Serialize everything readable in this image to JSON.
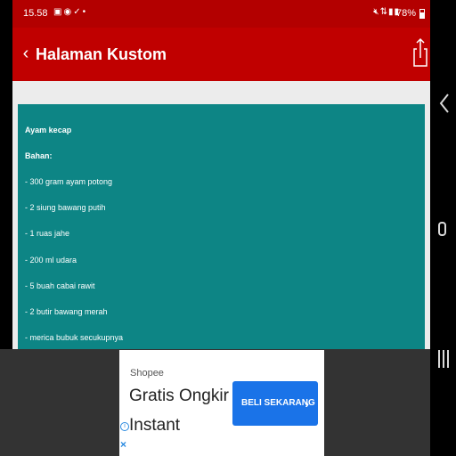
{
  "status_bar": {
    "time": "15.58",
    "left_icons": [
      "image-icon",
      "shield-icon",
      "check-icon",
      "dot-icon"
    ],
    "right_icons": [
      "mute-icon",
      "lte-icon",
      "signal-icon",
      "wifi-signal-icon"
    ],
    "battery_percent": "78%"
  },
  "app_bar": {
    "back_icon": "chevron-left-icon",
    "title": "Halaman Kustom",
    "share_icon": "share-icon"
  },
  "recipe": {
    "lines": [
      "Ayam kecap",
      "Bahan:",
      "- 300 gram ayam potong",
      "- 2 siung bawang putih",
      "- 1 ruas jahe",
      "- 200 ml udara",
      "- 5 buah cabai rawit",
      "- 2 butir bawang merah",
      "- merica bubuk secukupnya"
    ]
  },
  "ad": {
    "brand": "Shopee",
    "line1": "Gratis Ongkir",
    "line2": "Instant",
    "cta": "BELI SEKARANG",
    "cta_icon": "chevron-right-icon",
    "info_icon": "info-icon",
    "close_icon": "close-icon"
  },
  "colors": {
    "status_bar": "#b30000",
    "app_bar": "#c00000",
    "recipe_card": "#0d8585",
    "ad_cta": "#1a73e8"
  }
}
